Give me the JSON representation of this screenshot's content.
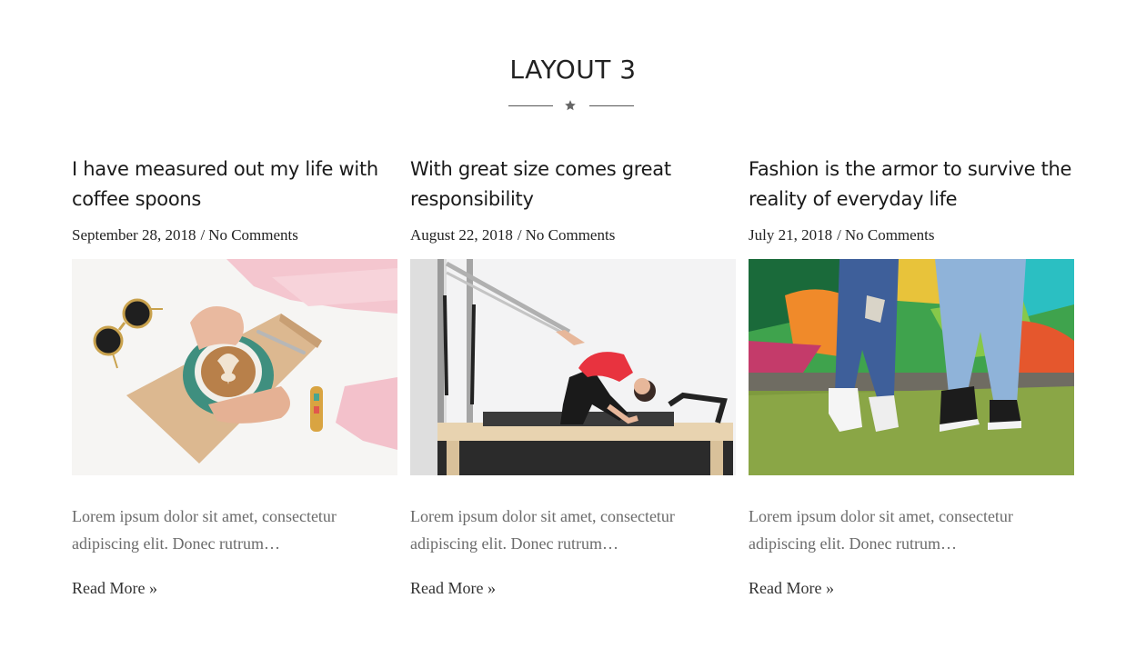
{
  "section": {
    "title": "LAYOUT 3"
  },
  "posts": [
    {
      "title": "I have measured out my life with coffee spoons",
      "date": "September 28, 2018",
      "separator": "/",
      "comments": "No Comments",
      "excerpt": "Lorem ipsum dolor sit amet, consectetur adipiscing elit. Donec rutrum…",
      "read_more": "Read More »",
      "image": "coffee-latte-art-photo"
    },
    {
      "title": "With great size comes great responsibility",
      "date": "August 22, 2018",
      "separator": "/",
      "comments": "No Comments",
      "excerpt": "Lorem ipsum dolor sit amet, consectetur adipiscing elit. Donec rutrum…",
      "read_more": "Read More »",
      "image": "pilates-reformer-photo"
    },
    {
      "title": "Fashion is the armor to survive the reality of everyday life",
      "date": "July 21, 2018",
      "separator": "/",
      "comments": "No Comments",
      "excerpt": "Lorem ipsum dolor sit amet, consectetur adipiscing elit. Donec rutrum…",
      "read_more": "Read More »",
      "image": "sneakers-graffiti-photo"
    }
  ],
  "colors": {
    "title": "#1a1a1a",
    "excerpt": "#6b6b6b",
    "divider": "#555555"
  }
}
